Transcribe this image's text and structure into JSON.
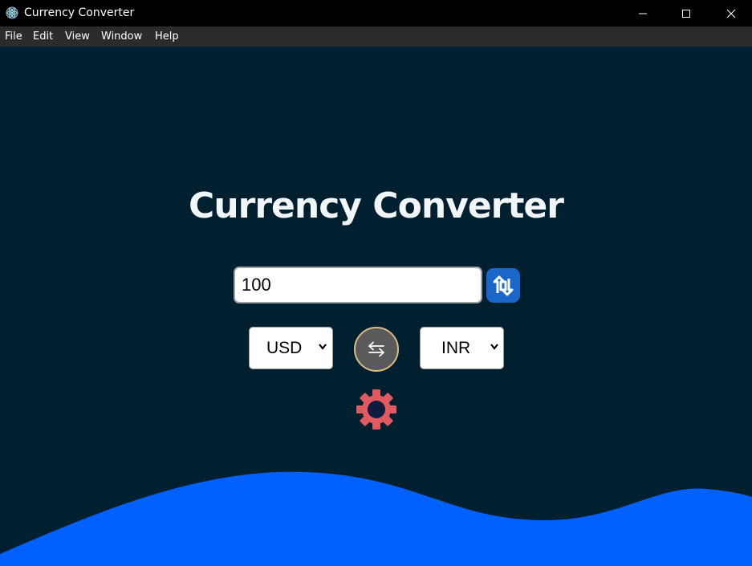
{
  "window": {
    "title": "Currency Converter",
    "icon": "electron-app-icon",
    "controls": [
      "minimize-icon",
      "maximize-icon",
      "close-icon"
    ]
  },
  "menu": {
    "items": [
      {
        "label": "File"
      },
      {
        "label": "Edit"
      },
      {
        "label": "View"
      },
      {
        "label": "Window"
      },
      {
        "label": "Help"
      }
    ]
  },
  "main": {
    "title": "Currency Converter",
    "amount": {
      "value": "100"
    },
    "convert_button": {
      "icon": "convert-arrows-icon"
    },
    "from_currency": {
      "selected": "USD"
    },
    "to_currency": {
      "selected": "INR"
    },
    "swap_button": {
      "icon": "swap-arrows-icon",
      "glyph": "⇆"
    },
    "settings_button": {
      "icon": "gear-icon"
    }
  },
  "colors": {
    "background": "#00202f",
    "wave": "#0061ff",
    "title_text": "#f2f6f8",
    "convert_button": "#1a67c9",
    "swap_button": "#5a5a5a",
    "swap_border": "#d9bb8a",
    "gear": "#e05a5f",
    "gear_center": "#0d1b3f"
  }
}
